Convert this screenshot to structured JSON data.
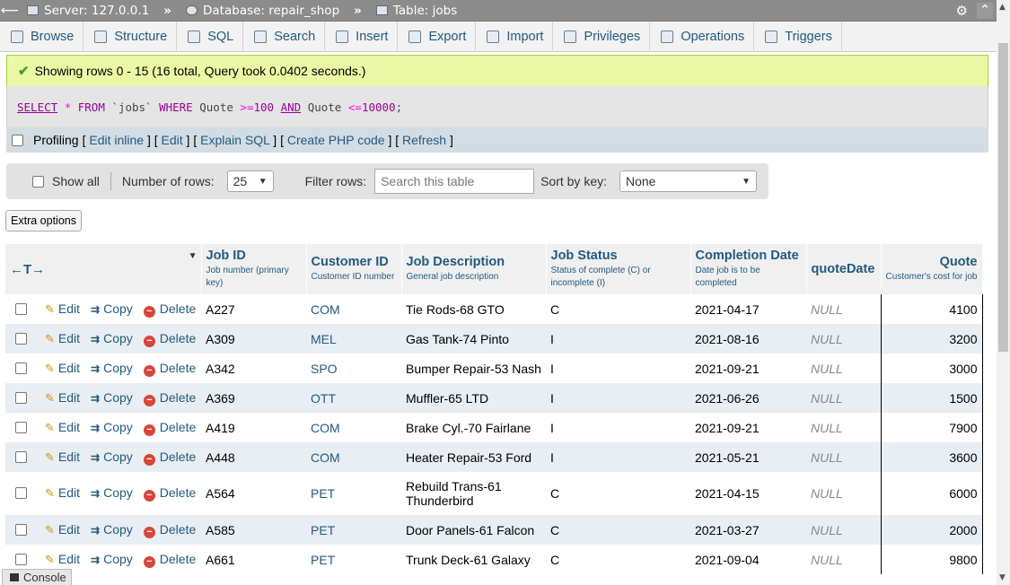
{
  "topbar": {
    "server": "Server: 127.0.0.1",
    "database": "Database: repair_shop",
    "table": "Table: jobs",
    "separator": "»"
  },
  "tabs": [
    {
      "label": "Browse",
      "icon": "browse-icon"
    },
    {
      "label": "Structure",
      "icon": "structure-icon"
    },
    {
      "label": "SQL",
      "icon": "sql-icon"
    },
    {
      "label": "Search",
      "icon": "search-icon"
    },
    {
      "label": "Insert",
      "icon": "insert-icon"
    },
    {
      "label": "Export",
      "icon": "export-icon"
    },
    {
      "label": "Import",
      "icon": "import-icon"
    },
    {
      "label": "Privileges",
      "icon": "privileges-icon"
    },
    {
      "label": "Operations",
      "icon": "operations-icon"
    },
    {
      "label": "Triggers",
      "icon": "triggers-icon"
    }
  ],
  "message": {
    "text": "Showing rows 0 - 15 (16 total, Query took 0.0402 seconds.)"
  },
  "sql": {
    "select": "SELECT",
    "star": "*",
    "from": "FROM",
    "table": "`jobs`",
    "where": "WHERE",
    "col1": "Quote",
    "op1": ">=",
    "val1": "100",
    "and": "AND",
    "col2": "Quote",
    "op2": "<=",
    "val2": "10000",
    "end": ";"
  },
  "profiling": {
    "label": "Profiling",
    "links": [
      "Edit inline",
      "Edit",
      "Explain SQL",
      "Create PHP code",
      "Refresh"
    ]
  },
  "nav": {
    "show_all": "Show all",
    "rows_label": "Number of rows:",
    "rows_value": "25",
    "filter_label": "Filter rows:",
    "filter_placeholder": "Search this table",
    "sort_label": "Sort by key:",
    "sort_value": "None"
  },
  "extra_options": "Extra options",
  "table": {
    "columns": [
      {
        "name": "Job ID",
        "comment": "Job number (primary key)"
      },
      {
        "name": "Customer ID",
        "comment": "Customer ID number"
      },
      {
        "name": "Job Description",
        "comment": "General job description"
      },
      {
        "name": "Job Status",
        "comment": "Status of complete (C) or incomplete (I)"
      },
      {
        "name": "Completion Date",
        "comment": "Date job is to be completed"
      },
      {
        "name": "quoteDate",
        "comment": ""
      },
      {
        "name": "Quote",
        "comment": "Customer's cost for job"
      }
    ],
    "actions": {
      "edit": "Edit",
      "copy": "Copy",
      "delete": "Delete"
    },
    "rows": [
      [
        "A227",
        "COM",
        "Tie Rods-68 GTO",
        "C",
        "2021-04-17",
        "NULL",
        "4100"
      ],
      [
        "A309",
        "MEL",
        "Gas Tank-74 Pinto",
        "I",
        "2021-08-16",
        "NULL",
        "3200"
      ],
      [
        "A342",
        "SPO",
        "Bumper Repair-53 Nash",
        "I",
        "2021-09-21",
        "NULL",
        "3000"
      ],
      [
        "A369",
        "OTT",
        "Muffler-65 LTD",
        "I",
        "2021-06-26",
        "NULL",
        "1500"
      ],
      [
        "A419",
        "COM",
        "Brake Cyl.-70 Fairlane",
        "I",
        "2021-09-21",
        "NULL",
        "7900"
      ],
      [
        "A448",
        "COM",
        "Heater Repair-53 Ford",
        "I",
        "2021-05-21",
        "NULL",
        "3600"
      ],
      [
        "A564",
        "PET",
        "Rebuild Trans-61 Thunderbird",
        "C",
        "2021-04-15",
        "NULL",
        "6000"
      ],
      [
        "A585",
        "PET",
        "Door Panels-61 Falcon",
        "C",
        "2021-03-27",
        "NULL",
        "2000"
      ],
      [
        "A661",
        "PET",
        "Trunk Deck-61 Galaxy",
        "C",
        "2021-09-04",
        "NULL",
        "9800"
      ]
    ]
  },
  "console": "Console"
}
